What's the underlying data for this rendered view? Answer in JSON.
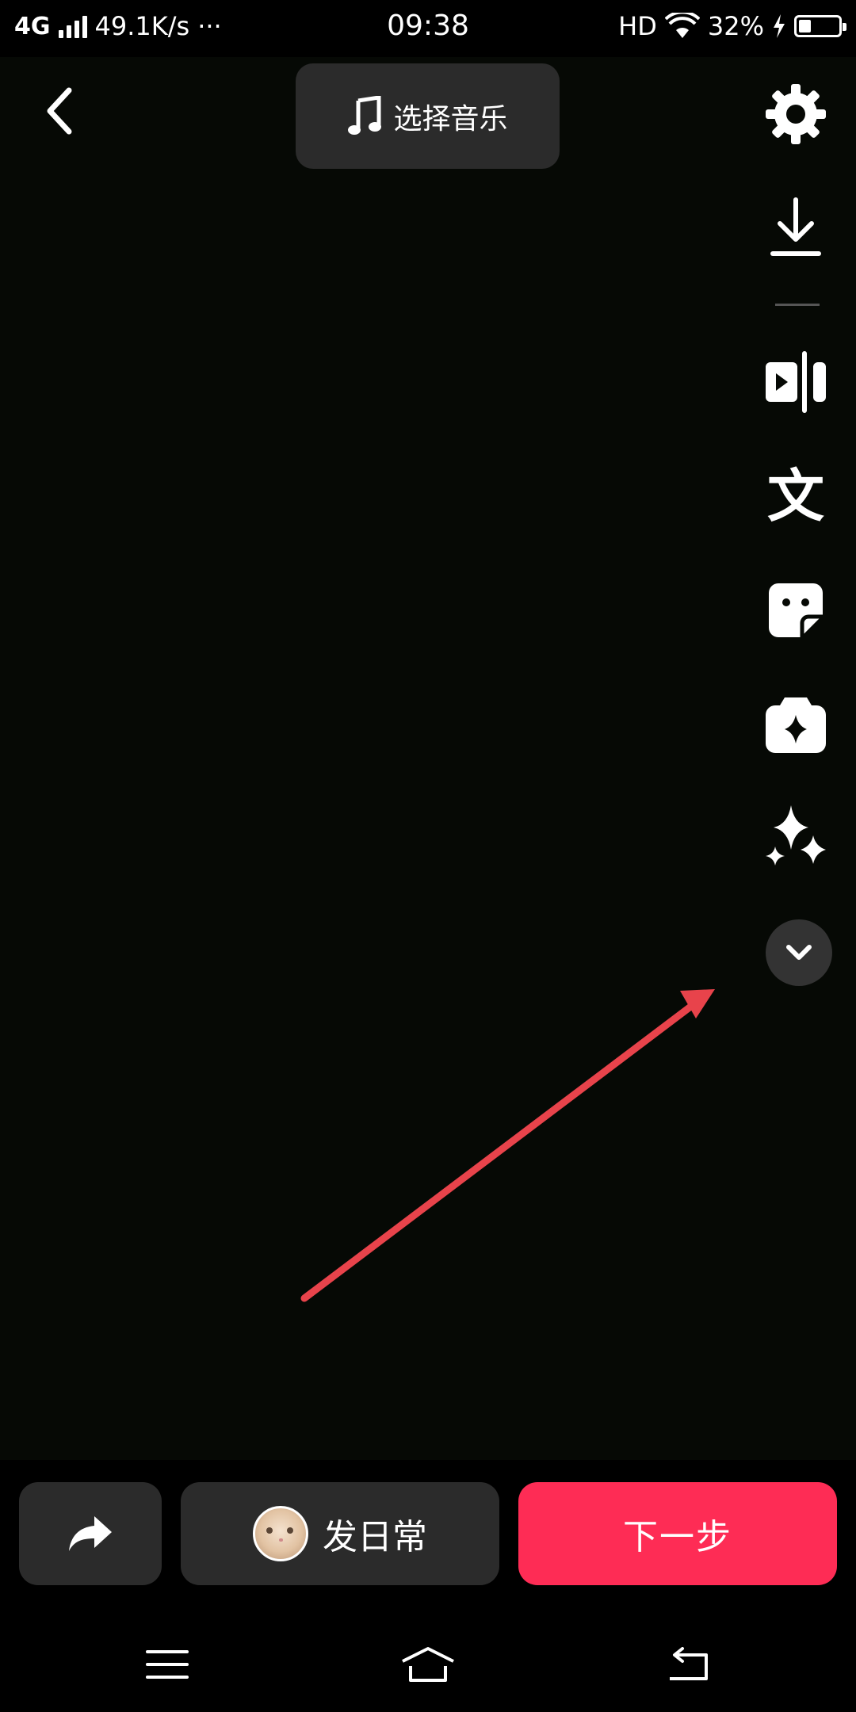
{
  "status_bar": {
    "network": "4G",
    "speed": "49.1K/s",
    "more": "···",
    "time": "09:38",
    "hd": "HD",
    "battery_text": "32%",
    "battery_level": 0.32,
    "charging": true
  },
  "header": {
    "back_icon": "chevron-left-icon",
    "music_label": "选择音乐",
    "music_icon": "music-note-icon"
  },
  "toolbar": {
    "items": [
      {
        "name": "settings",
        "icon": "gear-icon"
      },
      {
        "name": "download",
        "icon": "download-icon"
      },
      {
        "name": "clip",
        "icon": "video-clip-icon"
      },
      {
        "name": "text",
        "icon": "text-icon",
        "glyph": "文"
      },
      {
        "name": "sticker",
        "icon": "sticker-icon"
      },
      {
        "name": "effects",
        "icon": "effects-icon"
      },
      {
        "name": "enhance",
        "icon": "sparkles-icon"
      }
    ],
    "more_icon": "chevron-down-icon"
  },
  "annotation": {
    "color": "#e8434b"
  },
  "actions": {
    "share_icon": "share-arrow-icon",
    "daily_label": "发日常",
    "next_label": "下一步",
    "accent": "#fe2c55"
  },
  "nav_bar": {
    "menu_icon": "menu-icon",
    "home_icon": "home-icon",
    "back_icon": "back-icon"
  }
}
